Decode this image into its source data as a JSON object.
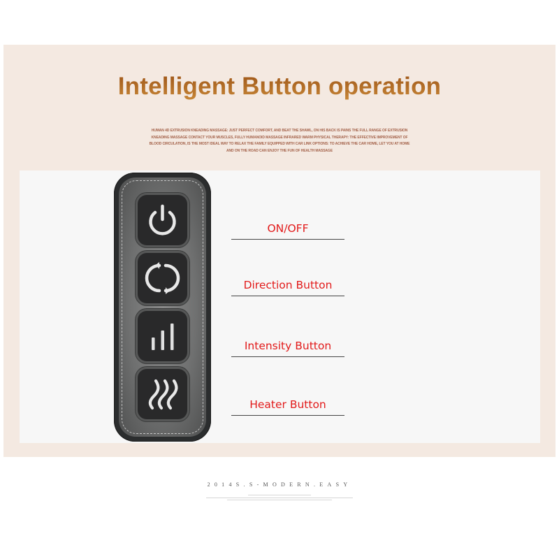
{
  "header": {
    "title": "Intelligent Button operation",
    "description": "Human 4D extrusion kneading massage: just perfect comfort, and beat the shawl, on his back is pains the full range of extrusion kneading massage contact your muscles, fully humanoid massage infrared warm physical therapy: the effective improvement of blood circulation, is the most ideal way to relax the family equipped with car link options: to achieve the car home, let you at home and on the road can enjoy the fun of health massage"
  },
  "colors": {
    "title": "#b26a26",
    "label": "#e21a1a",
    "beige_panel": "#f4e9e1",
    "inner_panel": "#f7f7f7",
    "remote_body": "#2b2d2e"
  },
  "remote": {
    "buttons": [
      {
        "id": "power",
        "icon": "power-icon",
        "label": "ON/OFF"
      },
      {
        "id": "direction",
        "icon": "rotate-direction-icon",
        "label": "Direction Button"
      },
      {
        "id": "intensity",
        "icon": "signal-bars-icon",
        "label": "Intensity Button"
      },
      {
        "id": "heater",
        "icon": "heat-waves-icon",
        "label": "Heater Button"
      }
    ]
  },
  "footer": {
    "brand": "2014S.S-MODERN.EASY"
  }
}
